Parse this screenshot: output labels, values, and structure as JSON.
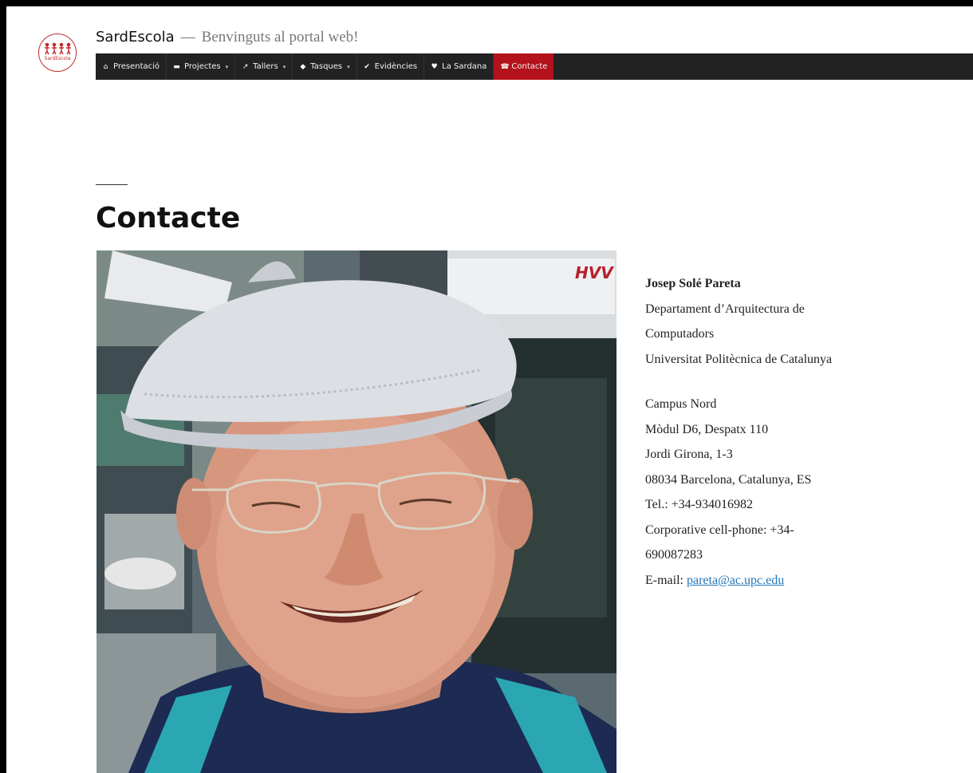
{
  "site": {
    "logo_text": "SardEscola",
    "title": "SardEscola",
    "separator": "—",
    "tagline": "Benvinguts al portal web!"
  },
  "nav": {
    "items": [
      {
        "label": "Presentació",
        "icon": "home-icon",
        "glyph": "⌂",
        "dropdown": false
      },
      {
        "label": "Projectes",
        "icon": "folder-icon",
        "glyph": "▬",
        "dropdown": true
      },
      {
        "label": "Tallers",
        "icon": "wrench-icon",
        "glyph": "↗",
        "dropdown": true
      },
      {
        "label": "Tasques",
        "icon": "tag-icon",
        "glyph": "◆",
        "dropdown": true
      },
      {
        "label": "Evidències",
        "icon": "check-icon",
        "glyph": "✔",
        "dropdown": false
      },
      {
        "label": "La Sardana",
        "icon": "heart-icon",
        "glyph": "♥",
        "dropdown": false
      },
      {
        "label": "Contacte",
        "icon": "phone-icon",
        "glyph": "☎",
        "dropdown": false,
        "active": true
      }
    ],
    "caret": "▾",
    "active_color": "#b3121c",
    "bar_color": "#222222"
  },
  "page": {
    "title": "Contacte"
  },
  "contact": {
    "name": "Josep Solé Pareta",
    "dept_line1": "Departament d’Arquitectura de",
    "dept_line2": "Computadors",
    "university": "Universitat Politècnica de Catalunya",
    "campus": "Campus Nord",
    "office": "Mòdul D6, Despatx 110",
    "street": "Jordi Girona, 1-3",
    "city": "08034 Barcelona, Catalunya, ES",
    "phone": "Tel.: +34-934016982",
    "cell_line1": "Corporative cell-phone: +34-",
    "cell_line2": "690087283",
    "email_label": "E-mail: ",
    "email": "pareta@ac.upc.edu",
    "link_color": "#2277bb"
  },
  "photo": {
    "sign_text": "HVV"
  }
}
